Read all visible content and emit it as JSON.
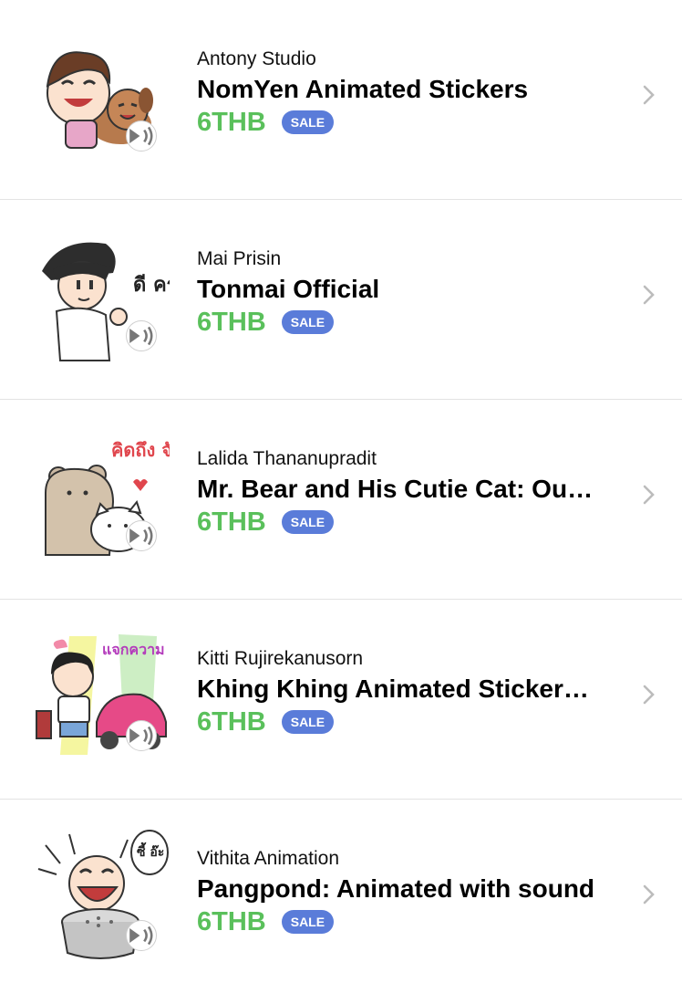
{
  "price_color": "#5ac05b",
  "sale_color": "#5a7cd9",
  "items": [
    {
      "author": "Antony Studio",
      "title": "NomYen Animated Stickers",
      "price": "6THB",
      "badge": "SALE",
      "thumb_icon": "girl-with-dog-sticker-icon",
      "sound_icon": "sound-play-icon"
    },
    {
      "author": "Mai Prisin",
      "title": "Tonmai Official",
      "price": "6THB",
      "badge": "SALE",
      "thumb_icon": "boy-waving-sticker-icon",
      "sound_icon": "sound-play-icon"
    },
    {
      "author": "Lalida Thananupradit",
      "title": "Mr. Bear and His Cutie Cat: Ou…",
      "price": "6THB",
      "badge": "SALE",
      "thumb_icon": "bear-and-cat-sticker-icon",
      "sound_icon": "sound-play-icon"
    },
    {
      "author": "Kitti Rujirekanusorn",
      "title": "Khing Khing Animated Sticker…",
      "price": "6THB",
      "badge": "SALE",
      "thumb_icon": "girl-with-car-sticker-icon",
      "sound_icon": "sound-play-icon"
    },
    {
      "author": "Vithita Animation",
      "title": "Pangpond: Animated with sound",
      "price": "6THB",
      "badge": "SALE",
      "thumb_icon": "boy-with-pot-sticker-icon",
      "sound_icon": "sound-play-icon"
    }
  ],
  "thumb_text": {
    "item2": "ดี ครับ",
    "item3": "คิดถึง จัง",
    "item4": "แจกความ สดใส",
    "item5": "ซี้ อ๊ะ"
  }
}
